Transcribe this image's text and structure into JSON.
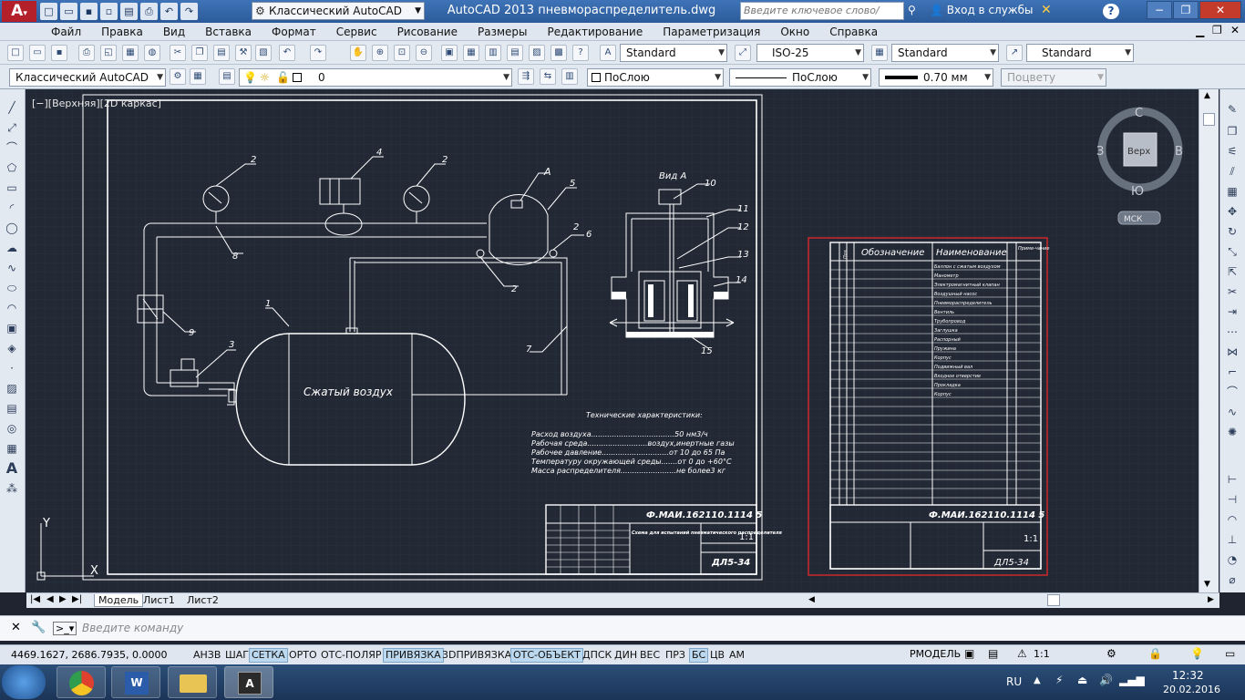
{
  "title_bar": {
    "workspace": "Классический AutoCAD",
    "app_title": "AutoCAD 2013    пневмораспределитель.dwg",
    "search_placeholder": "Введите ключевое слово/фразу",
    "login": "Вход в службы",
    "help": "?"
  },
  "menu": [
    "Файл",
    "Правка",
    "Вид",
    "Вставка",
    "Формат",
    "Сервис",
    "Рисование",
    "Размеры",
    "Редактирование",
    "Параметризация",
    "Окно",
    "Справка"
  ],
  "styles_toolbar": {
    "text_style": "Standard",
    "dim_style": "ISO-25",
    "table_style": "Standard",
    "mleader_style": "Standard"
  },
  "layers_toolbar": {
    "workspace": "Классический AutoCAD",
    "layer": "0",
    "color": "ПоСлою",
    "linetype": "ПоСлою",
    "lineweight": "0.70 мм",
    "plotstyle": "Поцвету"
  },
  "viewport": {
    "label": "[−][Верхняя][2D каркас]",
    "viewcube": {
      "n": "С",
      "s": "Ю",
      "w": "З",
      "e": "В",
      "face": "Верх",
      "ucs": "МСК"
    },
    "axis_y": "Y",
    "axis_x": "X"
  },
  "drawing": {
    "center_label": "Сжатый воздух",
    "view_label": "Вид А",
    "label_A": "А",
    "callouts": [
      "1",
      "2",
      "2",
      "2",
      "2",
      "3",
      "4",
      "5",
      "6",
      "7",
      "8",
      "9",
      "10",
      "11",
      "12",
      "13",
      "14",
      "15"
    ],
    "tech_title": "Технические характеристики:",
    "tech": [
      "Расход воздуха....................................50 нм3/ч",
      "Рабочая среда..........................воздух,инертные газы",
      "Рабочее давление.............................от 10 до 65 Па",
      "Температуру окружающей среды.......от 0 до +60°С",
      "Масса распределителя........................не более3 кг"
    ],
    "stamp_code": "Ф.МАИ.162110.1114 5",
    "stamp_name": "Схема для испытаний пневматического распределителя",
    "stamp_scale": "1:1",
    "stamp_group": "ДЛ5-34"
  },
  "spec_sheet": {
    "col_designation": "Обозначение",
    "col_name": "Наименование",
    "col_note": "Приме-чание",
    "col_pos": "Поз.",
    "items": [
      "Баллон с сжатым воздухом",
      "Манометр",
      "Электромагнитный клапан",
      "Воздушный насос",
      "Пневмораспределитель",
      "Вентиль",
      "Трубопровод",
      "Заглушка",
      "Распорный",
      "Пружина",
      "Корпус",
      "Подвижный вал",
      "Входное отверстие",
      "Прокладка",
      "Корпус"
    ],
    "stamp_code": "Ф.МАИ.162110.1114 5",
    "stamp_scale": "1:1",
    "stamp_group": "ДЛ5-34"
  },
  "layout_tabs": [
    "Модель",
    "Лист1",
    "Лист2"
  ],
  "command": {
    "placeholder": "Введите команду"
  },
  "status": {
    "coords": "4469.1627, 2686.7935, 0.0000",
    "buttons": [
      "АНЗВ",
      "ШАГ",
      "СЕТКА",
      "ОРТО",
      "ОТС-ПОЛЯР",
      "ПРИВЯЗКА",
      "3DПРИВЯЗКА",
      "ОТС-ОБЪЕКТ",
      "ДПСК",
      "ДИН",
      "ВЕС",
      "ПРЗ",
      "БС",
      "ЦВ",
      "АМ"
    ],
    "on": [
      false,
      false,
      true,
      false,
      false,
      true,
      false,
      true,
      false,
      false,
      false,
      false,
      true,
      false,
      false
    ],
    "model": "РМОДЕЛЬ",
    "scale": "1:1"
  },
  "taskbar": {
    "lang": "RU",
    "time": "12:32",
    "date": "20.02.2016"
  },
  "colors": {
    "canvas": "#222834",
    "line": "#ffffff",
    "accent_red": "#d82828"
  }
}
